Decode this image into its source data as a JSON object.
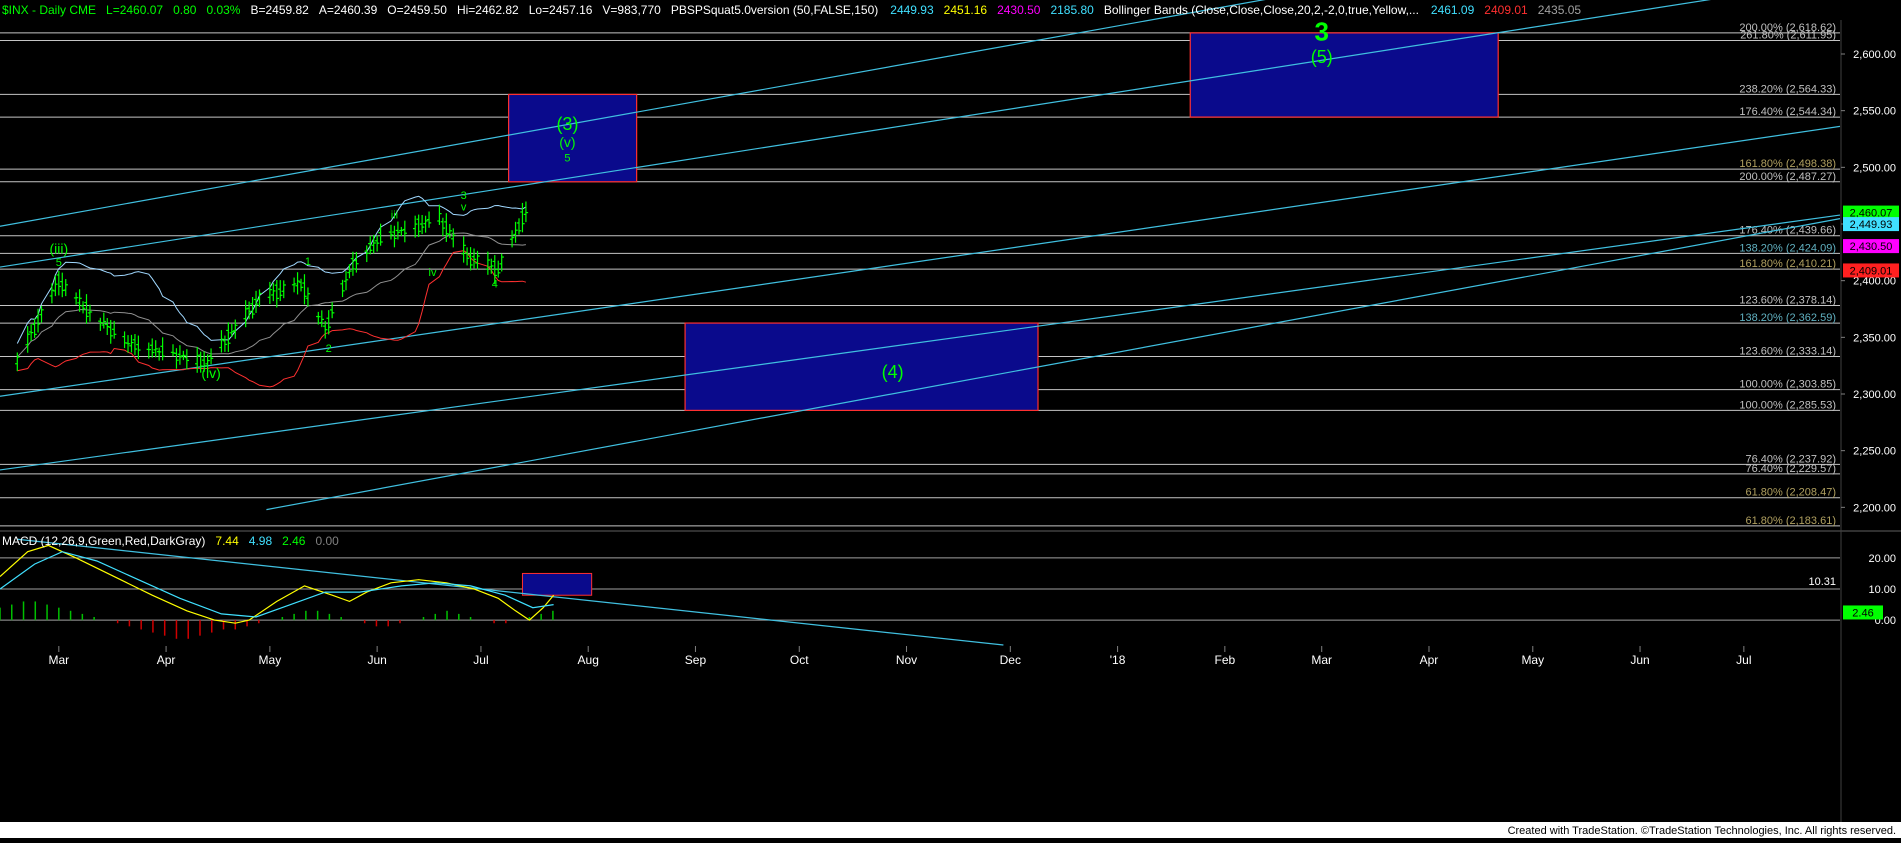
{
  "header": {
    "symbol": "$INX - Daily  CME",
    "quote": [
      {
        "text": "L=2460.07",
        "color": "#00ff00"
      },
      {
        "text": "0.80",
        "color": "#00ff00"
      },
      {
        "text": "0.03%",
        "color": "#00ff00"
      },
      {
        "text": "B=2459.82",
        "color": "#ffffff"
      },
      {
        "text": "A=2460.39",
        "color": "#ffffff"
      },
      {
        "text": "O=2459.50",
        "color": "#ffffff"
      },
      {
        "text": "Hi=2462.82",
        "color": "#ffffff"
      },
      {
        "text": "Lo=2457.16",
        "color": "#ffffff"
      },
      {
        "text": "V=983,770",
        "color": "#ffffff"
      }
    ],
    "study1": {
      "text": "PBSPSquat5.0version (50,FALSE,150)",
      "color": "#ffffff"
    },
    "study1_values": [
      {
        "text": "2449.93",
        "color": "#40e0ff"
      },
      {
        "text": "2451.16",
        "color": "#ffff00"
      },
      {
        "text": "2430.50",
        "color": "#ff00ff"
      },
      {
        "text": "2185.80",
        "color": "#40e0ff"
      }
    ],
    "study2": {
      "text": "Bollinger Bands (Close,Close,Close,20,2,-2,0,true,Yellow,...",
      "color": "#ffffff"
    },
    "study2_values": [
      {
        "text": "2461.09",
        "color": "#40e0ff"
      },
      {
        "text": "2409.01",
        "color": "#ff3030"
      },
      {
        "text": "2435.05",
        "color": "#a0a0a0"
      }
    ]
  },
  "macd_header": {
    "label": "MACD (12,26,9,Green,Red,DarkGray)",
    "values": [
      {
        "text": "7.44",
        "color": "#ffff00"
      },
      {
        "text": "4.98",
        "color": "#40e0ff"
      },
      {
        "text": "2.46",
        "color": "#00ff00"
      },
      {
        "text": "0.00",
        "color": "#808080"
      }
    ]
  },
  "footer": {
    "credit": "Created with TradeStation. ©TradeStation Technologies, Inc. All rights reserved."
  },
  "colors": {
    "background": "#000000",
    "bar": "#00ff00",
    "channel": "#40c0e0",
    "fib_line": "#e8e8e8",
    "box_fill": "#0a0a8c",
    "box_border": "#ff3030",
    "label_green": "#00ff00",
    "bb_upper": "#a0d8ff",
    "bb_lower": "#ff3030",
    "bb_mid": "#909090",
    "macd": "#ffff00",
    "signal": "#40e0ff",
    "hist_pos": "#00c000",
    "hist_neg": "#d00000"
  },
  "chart_data": [
    {
      "type": "bar",
      "subtype": "ohlc",
      "x_axis": {
        "labels": [
          "Mar",
          "Apr",
          "May",
          "Jun",
          "Jul",
          "Aug",
          "Sep",
          "Oct",
          "Nov",
          "Dec",
          "'18",
          "Feb",
          "Mar",
          "Apr",
          "May",
          "Jun",
          "Jul"
        ]
      },
      "y_axis": {
        "range": [
          2180,
          2630
        ],
        "ticks": [
          "2,200.00",
          "2,250.00",
          "2,300.00",
          "2,350.00",
          "2,400.00",
          "2,450.00",
          "2,500.00",
          "2,550.00",
          "2,600.00"
        ]
      },
      "price_path": [
        [
          "2017-02-17",
          2330
        ],
        [
          "2017-03-01",
          2400
        ],
        [
          "2017-03-10",
          2372
        ],
        [
          "2017-03-21",
          2345
        ],
        [
          "2017-04-13",
          2328
        ],
        [
          "2017-04-28",
          2385
        ],
        [
          "2017-05-10",
          2398
        ],
        [
          "2017-05-17",
          2358
        ],
        [
          "2017-05-25",
          2415
        ],
        [
          "2017-06-02",
          2438
        ],
        [
          "2017-06-09",
          2445
        ],
        [
          "2017-06-19",
          2455
        ],
        [
          "2017-06-27",
          2422
        ],
        [
          "2017-07-06",
          2410
        ],
        [
          "2017-07-14",
          2462
        ]
      ],
      "last_close": 2460.07,
      "price_tags": [
        {
          "text": "2,460.07",
          "value": 2460.07,
          "color": "#00ff00",
          "text_color": "#000000"
        },
        {
          "text": "2,449.93",
          "value": 2449.93,
          "color": "#40e0ff",
          "text_color": "#000000"
        },
        {
          "text": "2,430.50",
          "value": 2430.5,
          "color": "#ff00ff",
          "text_color": "#000000"
        },
        {
          "text": "2,409.01",
          "value": 2409.01,
          "color": "#ff2020",
          "text_color": "#000000"
        }
      ],
      "fib_levels": [
        {
          "label": "200.00% (2,618.62)",
          "value": 2618.62,
          "color": "#c0c0c0"
        },
        {
          "label": "261.80% (2,611.95)",
          "value": 2611.95,
          "color": "#c0c0c0"
        },
        {
          "label": "238.20% (2,564.33)",
          "value": 2564.33,
          "color": "#c0c0c0"
        },
        {
          "label": "176.40% (2,544.34)",
          "value": 2544.34,
          "color": "#c0c0c0"
        },
        {
          "label": "161.80% (2,498.38)",
          "value": 2498.38,
          "color": "#b0a060"
        },
        {
          "label": "200.00% (2,487.27)",
          "value": 2487.27,
          "color": "#c0c0c0"
        },
        {
          "label": "176.40% (2,439.66)",
          "value": 2439.66,
          "color": "#c0c0c0"
        },
        {
          "label": "138.20% (2,424.09)",
          "value": 2424.09,
          "color": "#60b0c0"
        },
        {
          "label": "161.80% (2,410.21)",
          "value": 2410.21,
          "color": "#b0a060"
        },
        {
          "label": "123.60% (2,378.14)",
          "value": 2378.14,
          "color": "#c0c0c0"
        },
        {
          "label": "138.20% (2,362.59)",
          "value": 2362.59,
          "color": "#60b0c0"
        },
        {
          "label": "123.60% (2,333.14)",
          "value": 2333.14,
          "color": "#c0c0c0"
        },
        {
          "label": "100.00% (2,303.85)",
          "value": 2303.85,
          "color": "#c0c0c0"
        },
        {
          "label": "100.00% (2,285.53)",
          "value": 2285.53,
          "color": "#c0c0c0"
        },
        {
          "label": "76.40% (2,237.92)",
          "value": 2237.92,
          "color": "#c0c0c0"
        },
        {
          "label": "76.40% (2,229.57)",
          "value": 2229.57,
          "color": "#c0c0c0"
        },
        {
          "label": "61.80% (2,208.47)",
          "value": 2208.47,
          "color": "#b0a060"
        },
        {
          "label": "61.80% (2,183.61)",
          "value": 2183.61,
          "color": "#b0a060"
        }
      ],
      "target_boxes": [
        {
          "name": "(3) target",
          "from": "2017-07-09",
          "to": "2017-08-15",
          "low": 2487.27,
          "high": 2564.33
        },
        {
          "name": "(4) target",
          "from": "2017-08-29",
          "to": "2017-12-09",
          "low": 2285.53,
          "high": 2362.59
        },
        {
          "name": "(5) target",
          "from": "2018-01-22",
          "to": "2018-04-21",
          "low": 2544.34,
          "high": 2618.62
        }
      ],
      "channels": [
        {
          "from": [
            "2017-02-12",
            2448
          ],
          "to": [
            "2017-09-01",
            2558
          ]
        },
        {
          "from": [
            "2017-02-12",
            2412
          ],
          "to": [
            "2017-09-01",
            2508
          ]
        },
        {
          "from": [
            "2017-02-12",
            2298
          ],
          "to": [
            "2017-09-01",
            2388
          ]
        },
        {
          "from": [
            "2017-02-12",
            2233
          ],
          "to": [
            "2017-09-01",
            2318
          ]
        },
        {
          "from": [
            "2017-04-30",
            2198
          ],
          "to": [
            "2017-09-01",
            2268
          ]
        }
      ],
      "annotations": [
        {
          "text": "(iii)",
          "date": "2017-03-01",
          "value": 2424,
          "size": "medium"
        },
        {
          "text": "5",
          "date": "2017-03-01",
          "value": 2413,
          "size": "small"
        },
        {
          "text": "(iv)",
          "date": "2017-04-14",
          "value": 2314,
          "size": "medium"
        },
        {
          "text": "1",
          "date": "2017-05-12",
          "value": 2414,
          "size": "small"
        },
        {
          "text": "2",
          "date": "2017-05-18",
          "value": 2337,
          "size": "small"
        },
        {
          "text": "iii",
          "date": "2017-06-06",
          "value": 2455,
          "size": "small"
        },
        {
          "text": "3",
          "date": "2017-06-26",
          "value": 2472,
          "size": "small"
        },
        {
          "text": "v",
          "date": "2017-06-26",
          "value": 2462,
          "size": "small"
        },
        {
          "text": "iv",
          "date": "2017-06-17",
          "value": 2404,
          "size": "small"
        },
        {
          "text": "4",
          "date": "2017-07-05",
          "value": 2394,
          "size": "small"
        },
        {
          "text": "(3)",
          "date": "2017-07-26",
          "value": 2533,
          "size": "large"
        },
        {
          "text": "(v)",
          "date": "2017-07-26",
          "value": 2518,
          "size": "medium"
        },
        {
          "text": "5",
          "date": "2017-07-26",
          "value": 2505,
          "size": "small"
        },
        {
          "text": "(4)",
          "date": "2017-10-28",
          "value": 2314,
          "size": "large"
        },
        {
          "text": "3",
          "date": "2018-03-01",
          "value": 2612,
          "size": "xlarge"
        },
        {
          "text": "(5)",
          "date": "2018-03-01",
          "value": 2592,
          "size": "large"
        }
      ]
    },
    {
      "type": "line",
      "title": "MACD (12,26,9,Green,Red,DarkGray)",
      "y_axis": {
        "range": [
          -8,
          28
        ],
        "ticks": [
          "20.00",
          "10.00",
          "0.00"
        ]
      },
      "level_label": {
        "text": "10.31",
        "value": 10.31
      },
      "series": [
        {
          "name": "MACD",
          "values": [
            [
              0,
              14
            ],
            [
              8,
              22
            ],
            [
              14,
              24
            ],
            [
              22,
              20
            ],
            [
              33,
              14
            ],
            [
              44,
              8
            ],
            [
              54,
              3
            ],
            [
              62,
              0
            ],
            [
              68,
              -1
            ],
            [
              72,
              0
            ],
            [
              80,
              6
            ],
            [
              88,
              11
            ],
            [
              96,
              8
            ],
            [
              101,
              6
            ],
            [
              106,
              9
            ],
            [
              113,
              12
            ],
            [
              121,
              13
            ],
            [
              129,
              12
            ],
            [
              137,
              10
            ],
            [
              144,
              7
            ],
            [
              149,
              3
            ],
            [
              153,
              0
            ],
            [
              157,
              4
            ],
            [
              160,
              8
            ]
          ]
        },
        {
          "name": "Signal",
          "values": [
            [
              0,
              10
            ],
            [
              10,
              18
            ],
            [
              18,
              22
            ],
            [
              28,
              19
            ],
            [
              40,
              13
            ],
            [
              52,
              7
            ],
            [
              64,
              2
            ],
            [
              74,
              1
            ],
            [
              84,
              5
            ],
            [
              94,
              9
            ],
            [
              104,
              9
            ],
            [
              116,
              11
            ],
            [
              126,
              12
            ],
            [
              136,
              11
            ],
            [
              146,
              8
            ],
            [
              154,
              4
            ],
            [
              160,
              5
            ]
          ]
        }
      ],
      "histogram": {
        "start_day": 0,
        "values": [
          4,
          5,
          6,
          6,
          5,
          4,
          3,
          2,
          1,
          0,
          -1,
          -2,
          -3,
          -4,
          -5,
          -6,
          -6,
          -5,
          -4,
          -3,
          -3,
          -2,
          -1,
          0,
          1,
          2,
          3,
          3,
          2,
          1,
          0,
          -1,
          -2,
          -2,
          -1,
          0,
          1,
          2,
          3,
          2,
          1,
          0,
          -1,
          -1,
          0,
          1,
          2,
          3
        ]
      },
      "trendline": {
        "from": [
          5,
          26
        ],
        "to": [
          290,
          -8
        ]
      },
      "zone": {
        "from_day": 151,
        "to_day": 171,
        "low": 8,
        "high": 15
      },
      "x_labels": [
        "Mar",
        "Apr",
        "May",
        "Jun",
        "Jul",
        "Aug",
        "Sep",
        "Oct",
        "Nov",
        "Dec",
        "'18",
        "Feb",
        "Mar",
        "Apr",
        "May",
        "Jun",
        "Jul"
      ],
      "last_value_tag": {
        "text": "2.46",
        "color": "#00ff00"
      }
    }
  ]
}
